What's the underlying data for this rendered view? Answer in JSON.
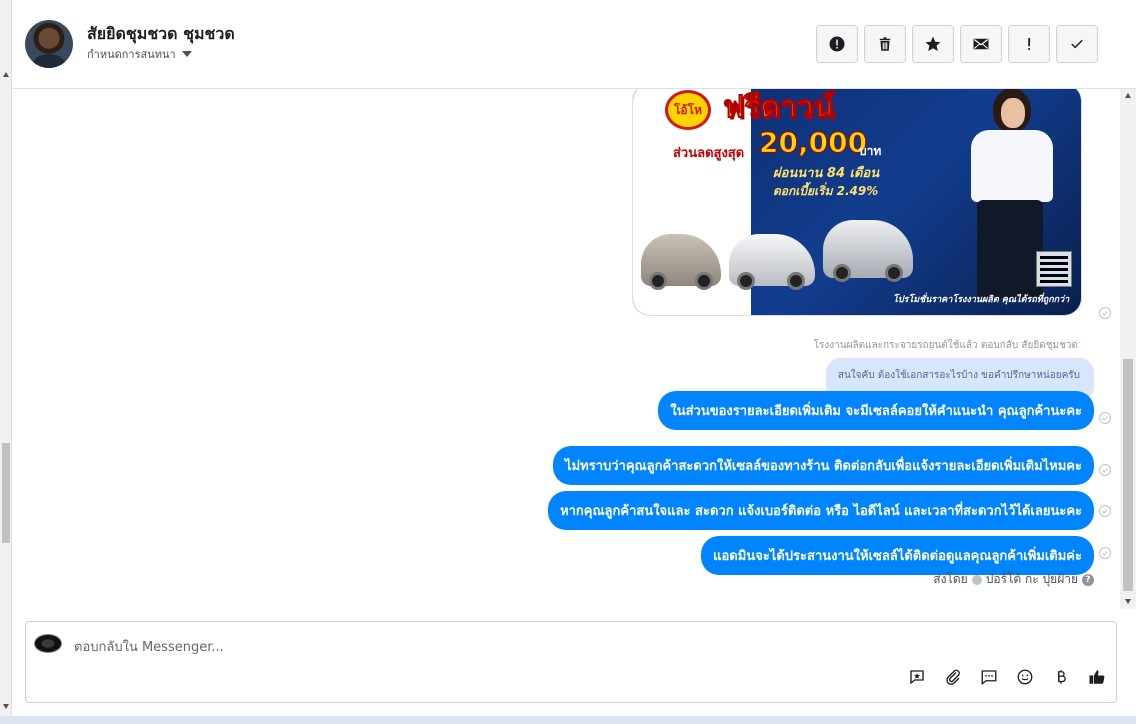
{
  "header": {
    "name": "สัยยิดชุมชวด ชุมชวด",
    "subtitle": "กำหนดการสนทนา",
    "actions": [
      {
        "name": "report",
        "label": "!"
      },
      {
        "name": "delete",
        "label": ""
      },
      {
        "name": "star",
        "label": ""
      },
      {
        "name": "mark-unread",
        "label": ""
      },
      {
        "name": "spam",
        "label": "!"
      },
      {
        "name": "done",
        "label": ""
      }
    ]
  },
  "promo": {
    "badge": "โอ้โห",
    "headline": "ฟรีดาวน์",
    "discount_label": "ส่วนลดสูงสุด",
    "amount": "20,000",
    "unit": "บาท",
    "installment": "ผ่อนนาน 84 เดือน",
    "interest": "ดอกเบี้ยเริ่ม 2.49%",
    "footer": "โปรโมชั่นราคาโรงงานผลิต คุณได้รถที่ถูกกว่า"
  },
  "reply": {
    "meta": "โรงงานผลิตและกระจายรถยนต์ใช้แล้ว ตอบกลับ สัยยิดชุมชวด",
    "quote": "สนใจคับ ต้องใช้เอกสารอะไรบ้าง ขอคำปรึกษาหน่อยครับ"
  },
  "messages": [
    "ในส่วนของรายละเอียดเพิ่มเติม จะมีเซลล์คอยให้คำแนะนำ คุณลูกค้านะคะ",
    "ไม่ทราบว่าคุณลูกค้าสะดวกให้เซลล์ของทางร้าน ติดต่อกลับเพื่อแจ้งรายละเอียดเพิ่มเติมไหมคะ",
    "หากคุณลูกค้าสนใจและ สะดวก แจ้งเบอร์ติดต่อ หรือ ไอดีไลน์ และเวลาที่สะดวกไว้ได้เลยนะคะ",
    "แอดมินจะได้ประสานงานให้เซลล์ได้ติดต่อดูแลคุณลูกค้าเพิ่มเติมค่ะ"
  ],
  "sent_by": {
    "prefix": "ส่งโดย",
    "agent": "ปอร์โต้ กะ ปุยฝ้าย",
    "help": "?"
  },
  "composer": {
    "placeholder": "ตอบกลับใน Messenger..."
  },
  "colors": {
    "bubble": "#0084ff",
    "quote": "#d8e6fb"
  }
}
